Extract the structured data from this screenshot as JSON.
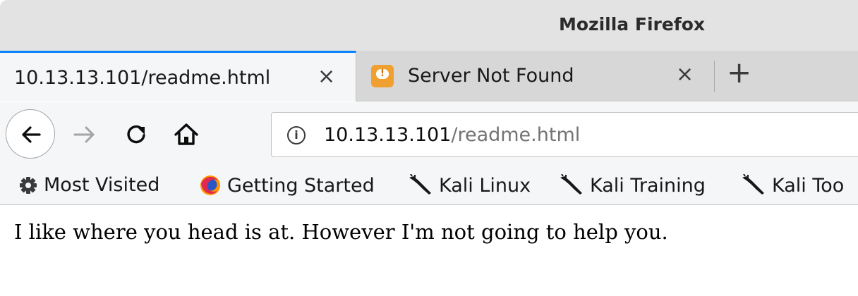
{
  "window": {
    "title": "Mozilla Firefox"
  },
  "tabs": [
    {
      "label": "10.13.13.101/readme.html",
      "active": true,
      "close": "×"
    },
    {
      "label": "Server Not Found",
      "active": false,
      "close": "×",
      "favicon": "warning-speech-icon"
    }
  ],
  "new_tab_label": "+",
  "url": {
    "host": "10.13.13.101",
    "path": "/readme.html"
  },
  "bookmarks": [
    {
      "label": "Most Visited",
      "icon": "gear-icon"
    },
    {
      "label": "Getting Started",
      "icon": "firefox-icon"
    },
    {
      "label": "Kali Linux",
      "icon": "kali-dragon-icon"
    },
    {
      "label": "Kali Training",
      "icon": "kali-dragon-icon"
    },
    {
      "label": "Kali Too",
      "icon": "kali-dragon-icon"
    }
  ],
  "page": {
    "text": "I like where you head is at. However I'm not going to help you."
  },
  "colors": {
    "accent": "#0a84ff",
    "toolbar": "#f5f6f7",
    "tabstrip": "#d7d7d8"
  }
}
